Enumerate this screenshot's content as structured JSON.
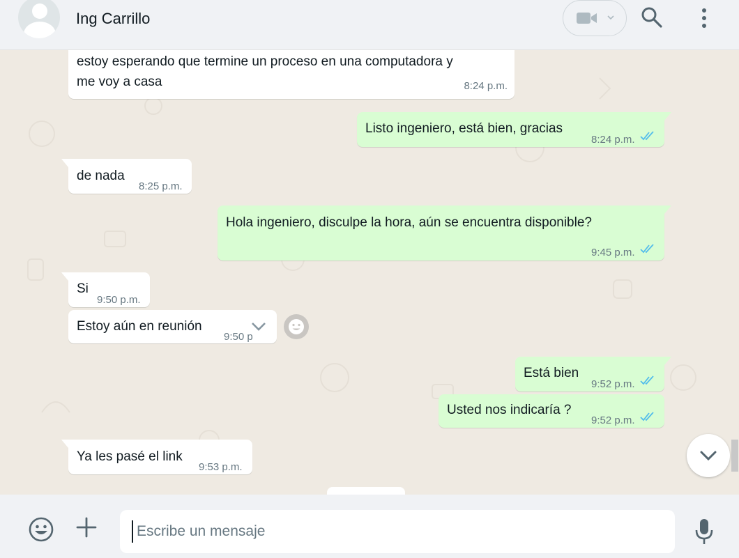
{
  "header": {
    "contact_name": "Ing Carrillo",
    "icons": [
      "avatar",
      "video-call-icon",
      "chevron-down-icon",
      "search-icon",
      "more-vert-icon"
    ]
  },
  "messages": [
    {
      "direction": "in",
      "lines": [
        "estoy esperando que termine un proceso en una computadora y",
        "me voy a casa"
      ],
      "time": "8:24 p.m."
    },
    {
      "direction": "out",
      "text": "Listo ingeniero, está bien, gracias",
      "time": "8:24 p.m.",
      "status": "read"
    },
    {
      "direction": "in",
      "text": "de nada",
      "time": "8:25 p.m."
    },
    {
      "direction": "out",
      "text": "Hola ingeniero, disculpe la hora, aún se encuentra disponible?",
      "time": "9:45 p.m.",
      "status": "read"
    },
    {
      "direction": "in",
      "text": "Si",
      "time": "9:50 p.m."
    },
    {
      "direction": "in",
      "text": "Estoy aún en reunión",
      "time": "9:50 p"
    },
    {
      "direction": "out",
      "text": "Está bien",
      "time": "9:52 p.m.",
      "status": "read"
    },
    {
      "direction": "out",
      "text": "Usted nos indicaría ?",
      "time": "9:52 p.m.",
      "status": "read"
    },
    {
      "direction": "in",
      "text": "Ya les pasé el link",
      "time": "9:53 p.m."
    }
  ],
  "composer": {
    "placeholder": "Escribe un mensaje"
  },
  "colors": {
    "incoming_bubble": "#ffffff",
    "outgoing_bubble": "#d9fdd3",
    "chat_background": "#efeae2",
    "read_ticks": "#53bdeb"
  }
}
